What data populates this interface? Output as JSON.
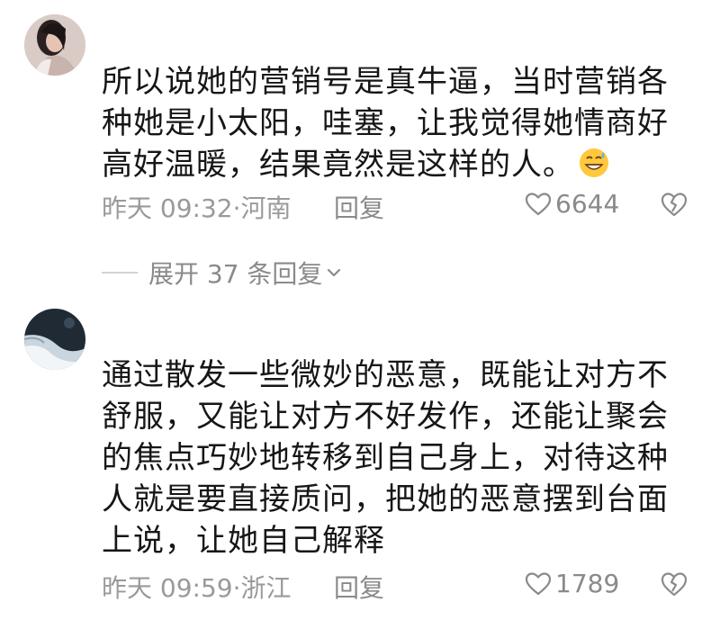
{
  "comments": [
    {
      "text": "所以说她的营销号是真牛逼，当时营销各种她是小太阳，哇塞，让我觉得她情商好高好温暖，结果竟然是这样的人。",
      "emoji": "grinning-sweat-emoji",
      "time_location": "昨天 09:32·河南",
      "reply_label": "回复",
      "likes": "6644"
    },
    {
      "text": "通过散发一些微妙的恶意，既能让对方不舒服，又能让对方不好发作，还能让聚会的焦点巧妙地转移到自己身上，对待这种人就是要直接质问，把她的恶意摆到台面上说，让她自己解释",
      "time_location": "昨天 09:59·浙江",
      "reply_label": "回复",
      "likes": "1789"
    }
  ],
  "expand_replies": {
    "label": "展开 37 条回复"
  },
  "colors": {
    "text": "#161616",
    "meta": "#9a9a9a",
    "divider": "#d2d2d2"
  }
}
